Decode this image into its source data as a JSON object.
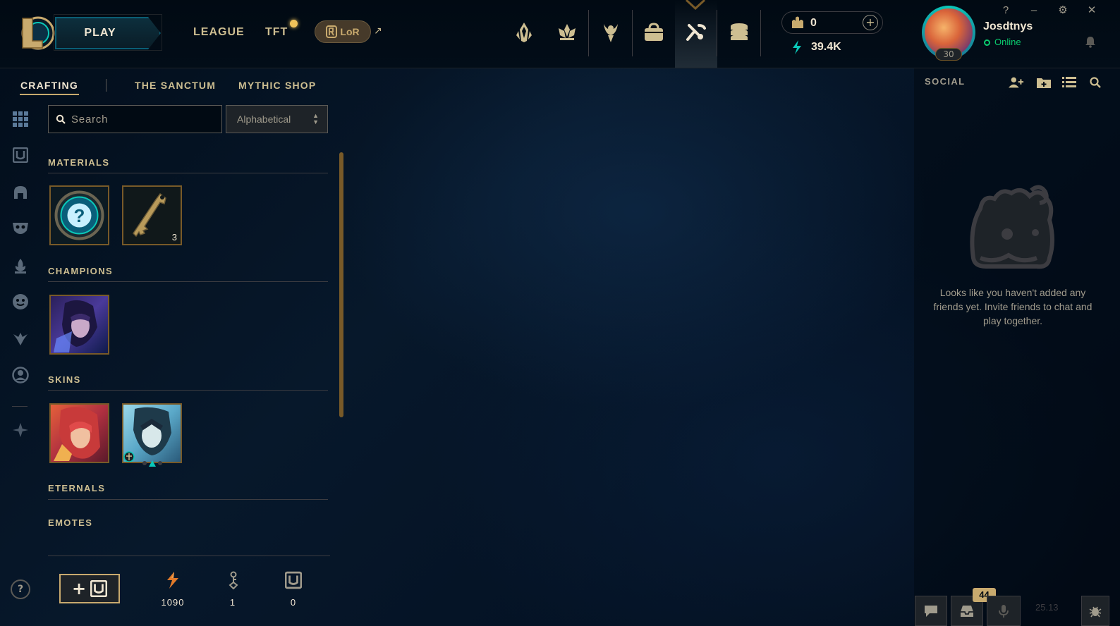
{
  "header": {
    "play_label": "PLAY",
    "nav": [
      {
        "label": "LEAGUE"
      },
      {
        "label": "TFT"
      }
    ],
    "lor_label": "LoR",
    "lor_arrow": "↗",
    "nav_icons": [
      "home-icon",
      "tft-icon",
      "profile-icon",
      "collection-icon",
      "loot-icon",
      "store-icon"
    ],
    "active_nav_icon": "loot-icon"
  },
  "wallet": {
    "rp": "0",
    "blue_essence": "39.4K",
    "add_label": "+"
  },
  "profile": {
    "username": "Josdtnys",
    "status": "Online",
    "level": "30"
  },
  "window_controls": {
    "help": "?",
    "minimize": "–",
    "settings": "⚙",
    "close": "✕"
  },
  "subnav": {
    "tabs": [
      {
        "label": "CRAFTING",
        "active": true
      },
      {
        "label": "THE SANCTUM"
      },
      {
        "label": "MYTHIC SHOP"
      }
    ]
  },
  "loot": {
    "search_placeholder": "Search",
    "sort_value": "Alphabetical",
    "sections": [
      {
        "title": "MATERIALS"
      },
      {
        "title": "CHAMPIONS"
      },
      {
        "title": "SKINS"
      },
      {
        "title": "ETERNALS"
      },
      {
        "title": "EMOTES"
      }
    ],
    "key_fragment_count": "3"
  },
  "totals": {
    "orange_essence": "1090",
    "keys": "1",
    "chests": "0"
  },
  "social": {
    "title": "SOCIAL",
    "empty_message": "Looks like you haven't added any friends yet. Invite friends to chat and play together."
  },
  "dock": {
    "notifications": "44",
    "version": "25.13"
  },
  "colors": {
    "gold": "#c8aa6e",
    "gold_light": "#f0e6d2",
    "teal": "#0ac8b9",
    "online": "#0acb6e",
    "background": "#010a13"
  }
}
